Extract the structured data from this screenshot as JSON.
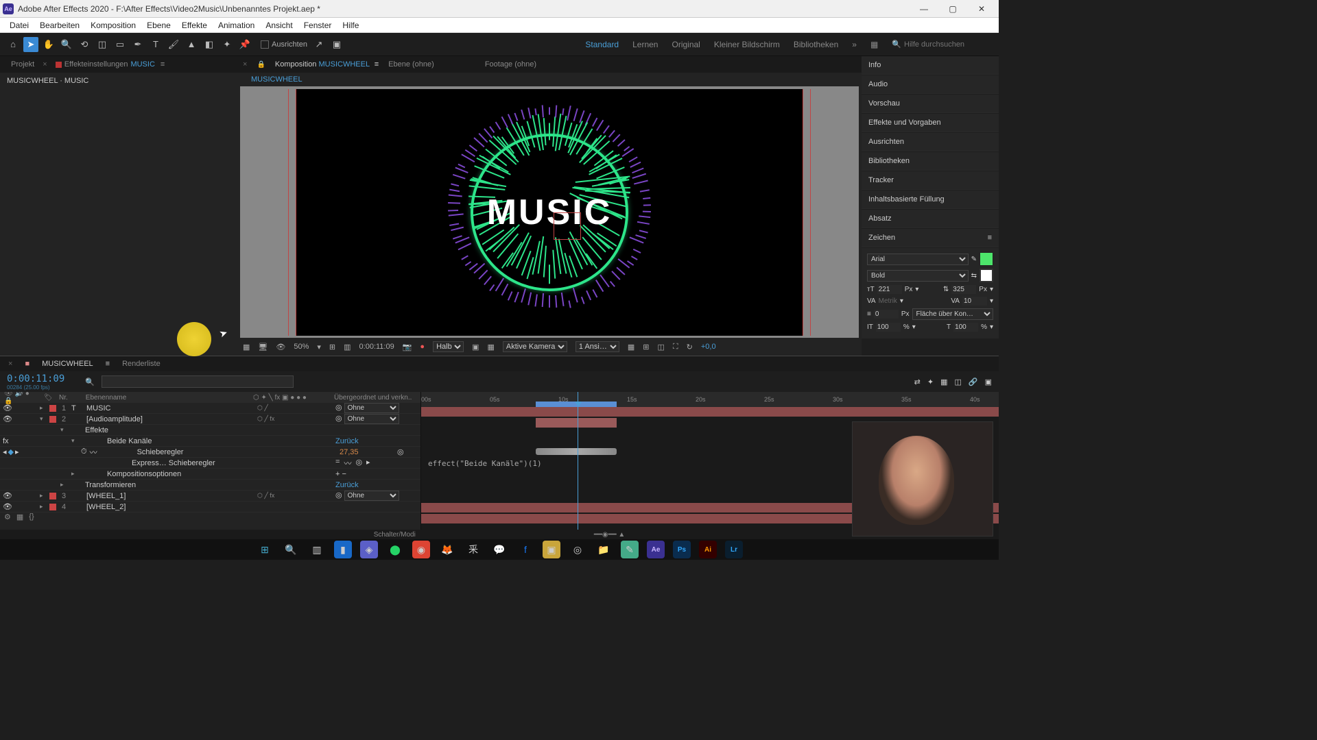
{
  "titlebar": {
    "app_icon": "Ae",
    "title": "Adobe After Effects 2020 - F:\\After Effects\\Video2Music\\Unbenanntes Projekt.aep *"
  },
  "menu": [
    "Datei",
    "Bearbeiten",
    "Komposition",
    "Ebene",
    "Effekte",
    "Animation",
    "Ansicht",
    "Fenster",
    "Hilfe"
  ],
  "toolbar": {
    "align_label": "Ausrichten",
    "search_placeholder": "Hilfe durchsuchen"
  },
  "workspaces": [
    "Standard",
    "Lernen",
    "Original",
    "Kleiner Bildschirm",
    "Bibliotheken"
  ],
  "left_panel": {
    "tab_projekt": "Projekt",
    "tab_effekt": "Effekteinstellungen",
    "effekt_target": "MUSIC",
    "breadcrumb": "MUSICWHEEL · MUSIC"
  },
  "center": {
    "tab_comp": "Komposition",
    "comp_name": "MUSICWHEEL",
    "tab_ebene": "Ebene (ohne)",
    "tab_footage": "Footage  (ohne)",
    "sub": "MUSICWHEEL",
    "viewport_text": "MUSIC",
    "footer": {
      "zoom": "50%",
      "timecode": "0:00:11:09",
      "res": "Halb",
      "cam": "Aktive Kamera",
      "view": "1 Ansi…",
      "exposure": "+0,0"
    }
  },
  "right_panel": {
    "items": [
      "Info",
      "Audio",
      "Vorschau",
      "Effekte und Vorgaben",
      "Ausrichten",
      "Bibliotheken",
      "Tracker",
      "Inhaltsbasierte Füllung",
      "Absatz"
    ],
    "zeichen_header": "Zeichen",
    "font": "Arial",
    "weight": "Bold",
    "size": "221",
    "size_unit": "Px",
    "leading": "325",
    "kern_label": "Metrik",
    "kern_v": "10",
    "baseline": "0",
    "baseline_unit": "Px",
    "fill_label": "Fläche über Kon…",
    "fill_color": "#4de56b",
    "hscale": "100",
    "hunit": "%",
    "vscale": "100",
    "vunit": "%"
  },
  "timeline": {
    "tab_name": "MUSICWHEEL",
    "tab_render": "Renderliste",
    "timecode": "0:00:11:09",
    "fps_note": "00284 (25.00 fps)",
    "col_nr": "Nr.",
    "col_name": "Ebenenname",
    "col_parent": "Übergeordnet und verkn..",
    "layers": {
      "l1_name": "MUSIC",
      "parent_none": "Ohne",
      "l2_name": "[Audioamplitude]",
      "effekte": "Effekte",
      "beide": "Beide Kanäle",
      "zurueck": "Zurück",
      "schieberegler": "Schieberegler",
      "schieb_val": "27,35",
      "express": "Express… Schieberegler",
      "kompopt": "Kompositionsoptionen",
      "transform": "Transformieren",
      "l3_name": "[WHEEL_1]",
      "l4_name": "[WHEEL_2]"
    },
    "expression": "effect(\"Beide Kanäle\")(1)",
    "ruler": [
      "00s",
      "05s",
      "10s",
      "15s",
      "20s",
      "25s",
      "30s",
      "35s",
      "40s"
    ],
    "footer": "Schalter/Modi"
  }
}
